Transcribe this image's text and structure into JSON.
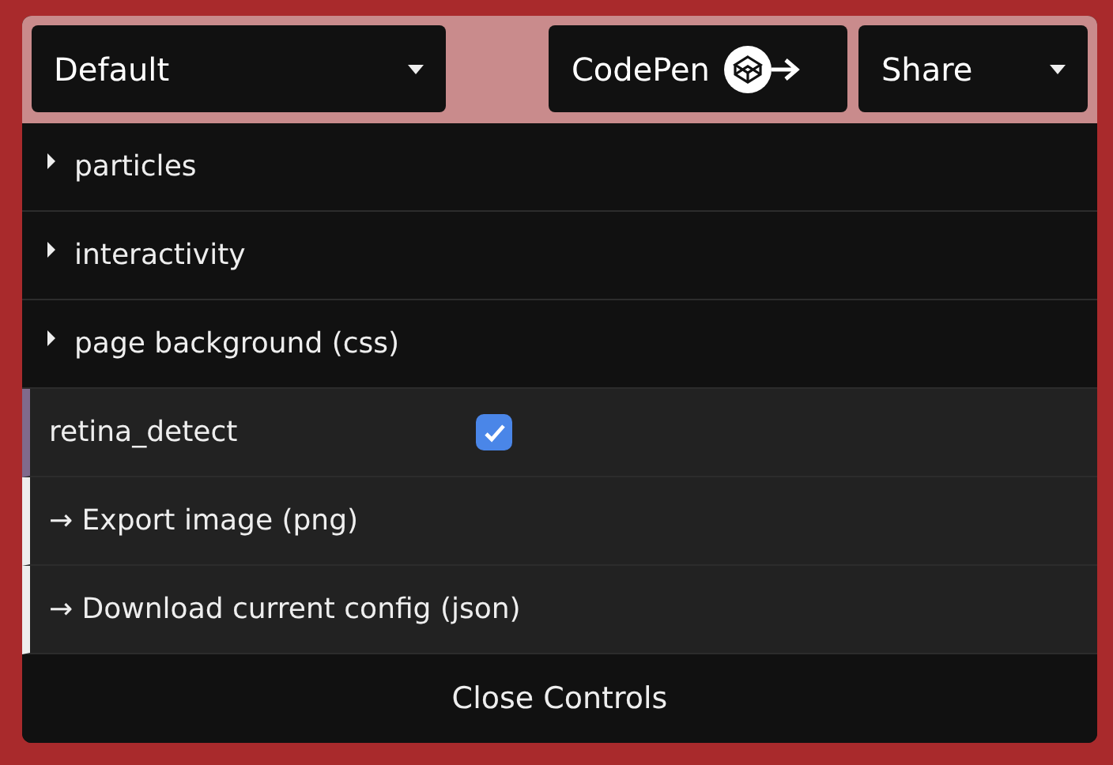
{
  "preset_select": {
    "value": "Default"
  },
  "codepen_button": {
    "label": "CodePen"
  },
  "share_select": {
    "value": "Share"
  },
  "controls": [
    {
      "kind": "folder",
      "label": "particles",
      "expanded": false
    },
    {
      "kind": "folder",
      "label": "interactivity",
      "expanded": false
    },
    {
      "kind": "folder",
      "label": "page background (css)",
      "expanded": false
    },
    {
      "kind": "checkbox",
      "label": "retina_detect",
      "checked": true
    },
    {
      "kind": "function",
      "label": "→ Export image (png)"
    },
    {
      "kind": "function",
      "label": "→ Download current config (json)"
    }
  ],
  "close_button": {
    "label": "Close Controls"
  }
}
